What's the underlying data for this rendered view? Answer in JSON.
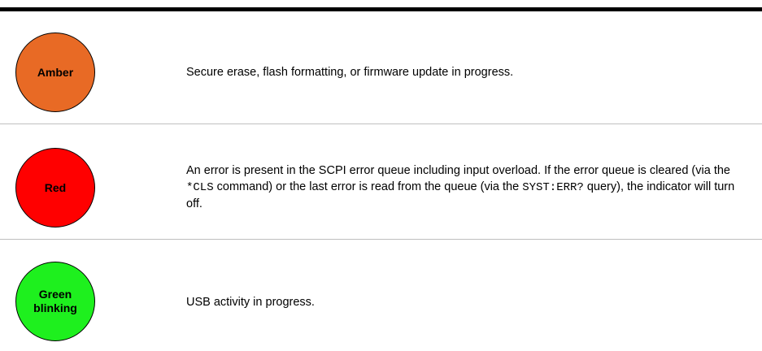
{
  "rows": [
    {
      "color_label_lines": [
        "Amber"
      ],
      "color": "#E86A25",
      "description": "Secure erase, flash formatting, or firmware update in progress."
    },
    {
      "color_label_lines": [
        "Red"
      ],
      "color": "#FF0000",
      "description_parts": [
        "An error is present in the SCPI error queue including input overload. If the error queue is cleared (via the ",
        "*CLS",
        " command) or the last error is read from the queue (via the ",
        "SYST:ERR?",
        " query), the indicator will turn off."
      ]
    },
    {
      "color_label_lines": [
        "Green",
        "blinking"
      ],
      "color": "#1EF01E",
      "description": "USB activity in progress."
    }
  ]
}
